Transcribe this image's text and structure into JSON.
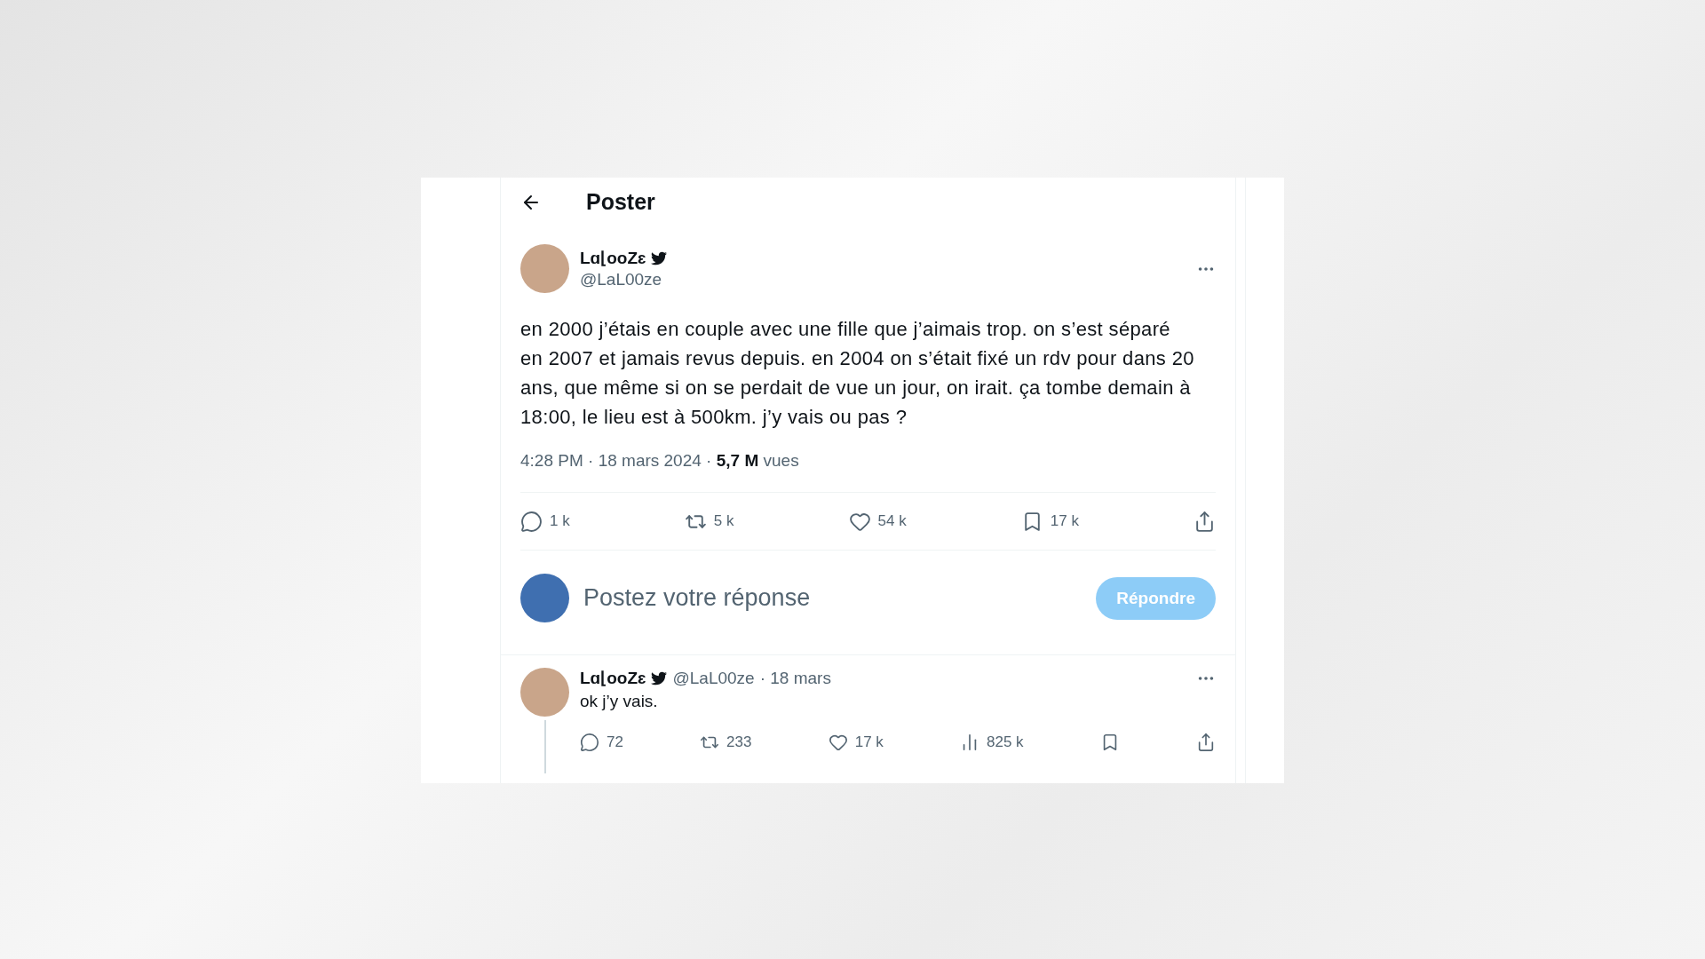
{
  "header": {
    "title": "Poster"
  },
  "post": {
    "author": {
      "name": "Lɑ⌊ooZɛ",
      "handle": "@LaL00ze"
    },
    "text": "en 2000 j’étais en couple avec une fille que j’aimais trop. on s’est séparé en 2007 et jamais revus depuis. en 2004 on s’était fixé un rdv pour dans 20 ans, que même si on se perdait de vue un jour, on irait. ça tombe demain à 18:00, le lieu est à 500km. j’y vais ou pas ?",
    "meta": "4:28 PM · 18 mars 2024 · **5,7 M** vues",
    "actions": [
      {
        "kind": "reply",
        "count": "1 k"
      },
      {
        "kind": "repost",
        "count": "5 k"
      },
      {
        "kind": "like",
        "count": "54 k"
      },
      {
        "kind": "bookmark",
        "count": "17 k"
      },
      {
        "kind": "share"
      }
    ]
  },
  "composer": {
    "placeholder": "Postez votre réponse",
    "button": "Répondre",
    "disabled": true
  },
  "reply": {
    "author": {
      "name": "Lɑ⌊ooZɛ",
      "handle": "@LaL00ze"
    },
    "date": "· 18 mars",
    "text": "ok j’y vais.",
    "actions": [
      {
        "kind": "reply",
        "count": "72"
      },
      {
        "kind": "repost",
        "count": "233"
      },
      {
        "kind": "like",
        "count": "17 k"
      },
      {
        "kind": "views",
        "count": "825 k"
      },
      {
        "kind": "bookmark"
      },
      {
        "kind": "share"
      }
    ]
  }
}
